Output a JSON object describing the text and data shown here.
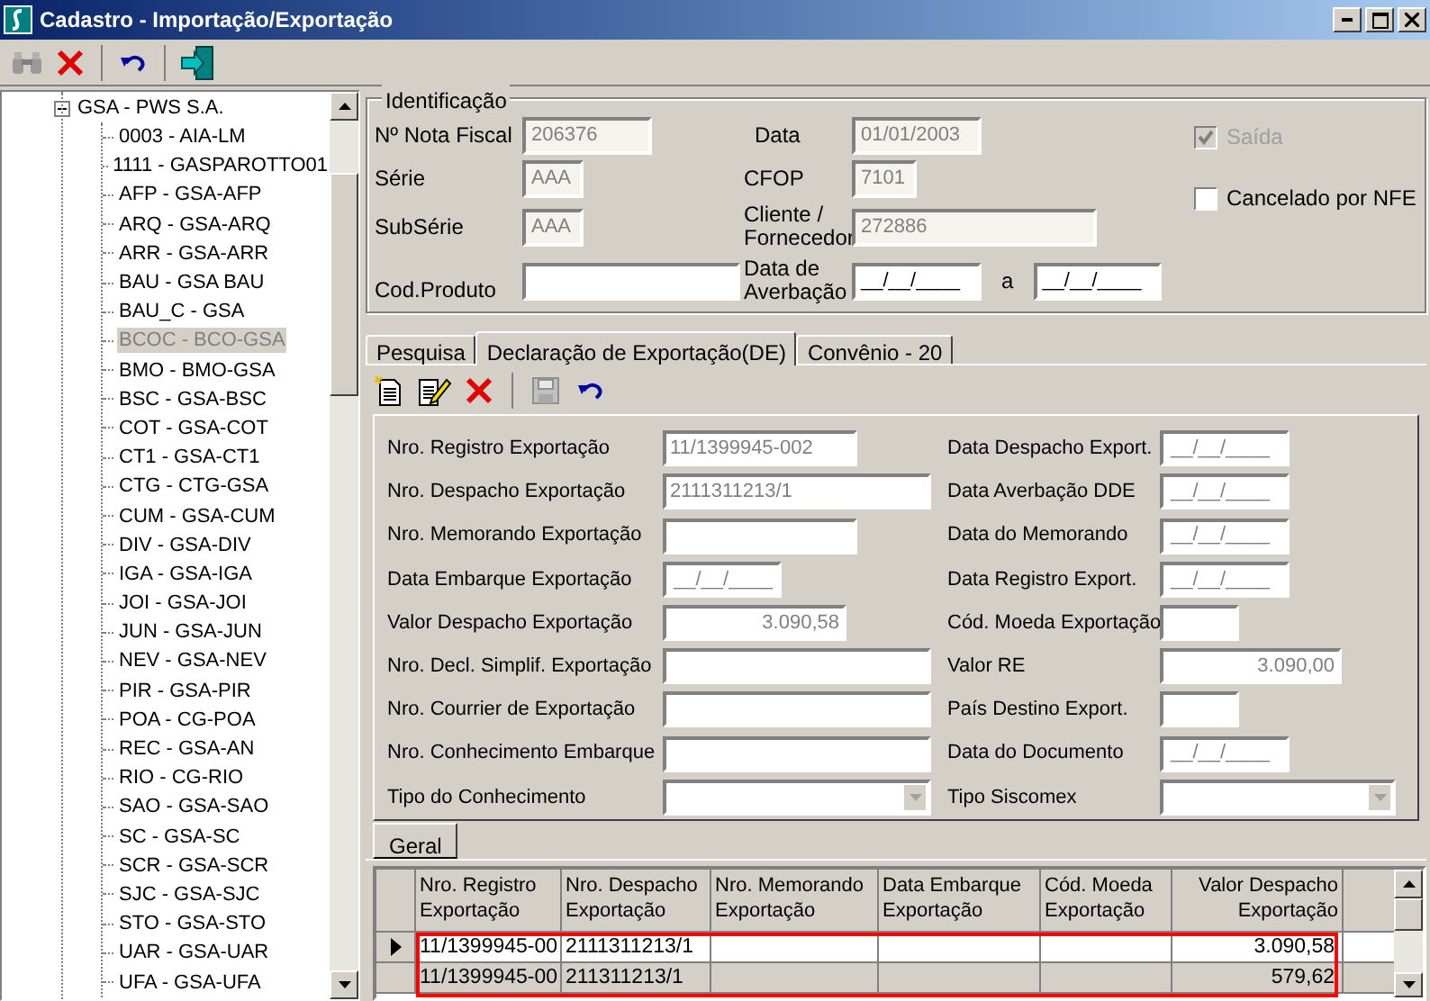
{
  "window": {
    "title": "Cadastro - Importação/Exportação"
  },
  "tree": {
    "label": "GSA - PWS S.A.",
    "expanded": true,
    "children": [
      {
        "label": "0003 - AIA-LM",
        "selected": false
      },
      {
        "label": "1111 - GASPAROTTO01",
        "selected": false
      },
      {
        "label": "AFP - GSA-AFP",
        "selected": false
      },
      {
        "label": "ARQ - GSA-ARQ",
        "selected": false
      },
      {
        "label": "ARR - GSA-ARR",
        "selected": false
      },
      {
        "label": "BAU - GSA BAU",
        "selected": false
      },
      {
        "label": "BAU_C - GSA",
        "selected": false
      },
      {
        "label": "BCOC - BCO-GSA",
        "selected": true
      },
      {
        "label": "BMO - BMO-GSA",
        "selected": false
      },
      {
        "label": "BSC - GSA-BSC",
        "selected": false
      },
      {
        "label": "COT - GSA-COT",
        "selected": false
      },
      {
        "label": "CT1 - GSA-CT1",
        "selected": false
      },
      {
        "label": "CTG - CTG-GSA",
        "selected": false
      },
      {
        "label": "CUM - GSA-CUM",
        "selected": false
      },
      {
        "label": "DIV - GSA-DIV",
        "selected": false
      },
      {
        "label": "IGA - GSA-IGA",
        "selected": false
      },
      {
        "label": "JOI - GSA-JOI",
        "selected": false
      },
      {
        "label": "JUN - GSA-JUN",
        "selected": false
      },
      {
        "label": "NEV - GSA-NEV",
        "selected": false
      },
      {
        "label": "PIR - GSA-PIR",
        "selected": false
      },
      {
        "label": "POA - CG-POA",
        "selected": false
      },
      {
        "label": "REC - GSA-AN",
        "selected": false
      },
      {
        "label": "RIO - CG-RIO",
        "selected": false
      },
      {
        "label": "SAO - GSA-SAO",
        "selected": false
      },
      {
        "label": "SC - GSA-SC",
        "selected": false
      },
      {
        "label": "SCR - GSA-SCR",
        "selected": false
      },
      {
        "label": "SJC - GSA-SJC",
        "selected": false
      },
      {
        "label": "STO - GSA-STO",
        "selected": false
      },
      {
        "label": "UAR - GSA-UAR",
        "selected": false
      },
      {
        "label": "UFA - GSA-UFA",
        "selected": false
      }
    ]
  },
  "identificacao": {
    "title": "Identificação",
    "left_fields": [
      {
        "label": "Nº Nota Fiscal",
        "value": "206376",
        "disabled": true
      },
      {
        "label": "Série",
        "value": "AAA",
        "disabled": true
      },
      {
        "label": "SubSérie",
        "value": "AAA",
        "disabled": true
      },
      {
        "label": "Cod.Produto",
        "disabled": false
      }
    ],
    "middle_fields": [
      {
        "label": "Data",
        "value": "01/01/2003",
        "disabled": true
      },
      {
        "label": "CFOP",
        "value": "7101",
        "disabled": true
      },
      {
        "label": "Cliente / Fornecedor",
        "value": "272886",
        "disabled": true
      },
      {
        "label": "Data de Averbação",
        "value": "__/__/____",
        "disabled": false
      }
    ],
    "range_separator": "a",
    "range_end": {
      "value": "__/__/____"
    },
    "checkboxes": [
      {
        "label": "Saída",
        "checked": true,
        "disabled": true
      },
      {
        "label": "Cancelado por NFE",
        "checked": false,
        "disabled": false
      }
    ]
  },
  "tabs": [
    {
      "label": "Pesquisa",
      "selected": false
    },
    {
      "label": "Declaração de Exportação(DE)",
      "selected": true
    },
    {
      "label": "Convênio - 20",
      "selected": false
    }
  ],
  "form": {
    "left": [
      {
        "label": "Nro. Registro Exportação",
        "value": "11/1399945-002",
        "kind": "text"
      },
      {
        "label": "Nro. Despacho Exportação",
        "value": "2111311213/1",
        "kind": "text"
      },
      {
        "label": "Nro. Memorando Exportação",
        "kind": "text"
      },
      {
        "label": "Data Embarque Exportação",
        "value": "__/__/____",
        "kind": "date"
      },
      {
        "label": "Valor Despacho Exportação",
        "value": "3.090,58",
        "kind": "number"
      },
      {
        "label": "Nro. Decl. Simplif. Exportação",
        "kind": "text"
      },
      {
        "label": "Nro. Courrier de Exportação",
        "kind": "text"
      },
      {
        "label": "Nro. Conhecimento Embarque",
        "kind": "text"
      },
      {
        "label": "Tipo do Conhecimento",
        "kind": "combo"
      }
    ],
    "right": [
      {
        "label": "Data Despacho Export.",
        "value": "__/__/____",
        "kind": "date"
      },
      {
        "label": "Data Averbação DDE",
        "value": "__/__/____",
        "kind": "date"
      },
      {
        "label": "Data do Memorando",
        "value": "__/__/____",
        "kind": "date"
      },
      {
        "label": "Data Registro Export.",
        "value": "__/__/____",
        "kind": "date"
      },
      {
        "label": "Cód. Moeda Exportação",
        "kind": "short"
      },
      {
        "label": "Valor RE",
        "value": "3.090,00",
        "kind": "number"
      },
      {
        "label": "País Destino Export.",
        "kind": "short"
      },
      {
        "label": "Data do Documento",
        "value": "__/__/____",
        "kind": "date"
      },
      {
        "label": "Tipo Siscomex",
        "kind": "combo"
      }
    ]
  },
  "grid_tab": {
    "label": "Geral"
  },
  "table": {
    "columns": [
      "Nro. Registro Exportação",
      "Nro. Despacho Exportação",
      "Nro. Memorando Exportação",
      "Data Embarque Exportação",
      "Cód. Moeda Exportação",
      "Valor Despacho Exportação"
    ],
    "rows": [
      {
        "selected": true,
        "cells": [
          "11/1399945-00",
          "2111311213/1",
          "",
          "",
          "",
          "3.090,58"
        ]
      },
      {
        "selected": false,
        "cells": [
          "11/1399945-00",
          "211311213/1",
          "",
          "",
          "",
          "579,62"
        ]
      }
    ]
  }
}
